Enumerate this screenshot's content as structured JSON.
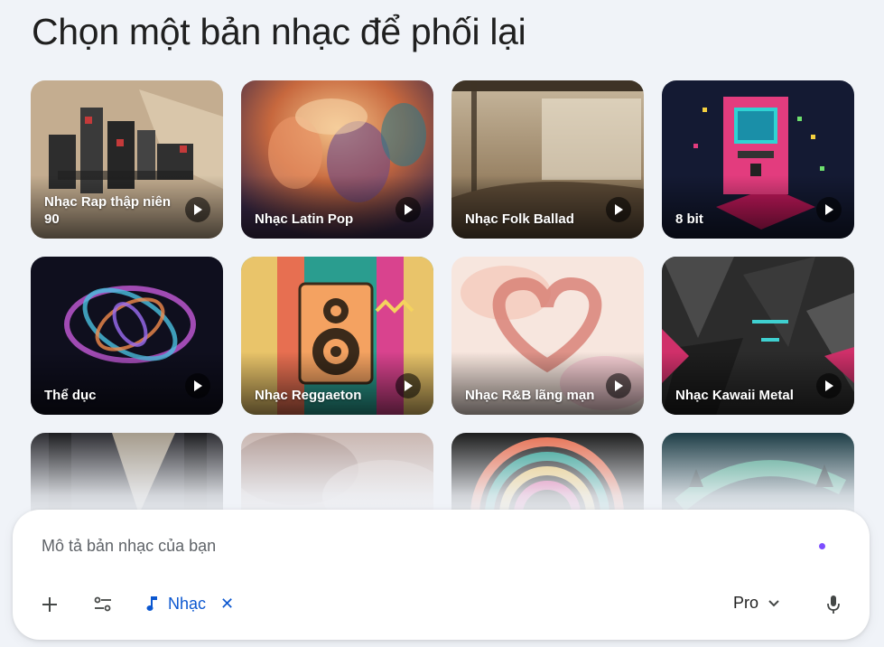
{
  "page": {
    "title": "Chọn một bản nhạc để phối lại"
  },
  "cards": [
    {
      "label": "Nhạc Rap thập niên 90"
    },
    {
      "label": "Nhạc Latin Pop"
    },
    {
      "label": "Nhạc Folk Ballad"
    },
    {
      "label": "8 bit"
    },
    {
      "label": "Thể dục"
    },
    {
      "label": "Nhạc Reggaeton"
    },
    {
      "label": "Nhạc R&B lãng mạn"
    },
    {
      "label": "Nhạc Kawaii Metal"
    }
  ],
  "composer": {
    "placeholder": "Mô tả bản nhạc của bạn",
    "chip_label": "Nhạc",
    "model_label": "Pro"
  },
  "icons": [
    "plus-icon",
    "tune-icon",
    "music-note-icon",
    "close-icon",
    "chevron-down-icon",
    "mic-icon",
    "play-icon"
  ],
  "colors": {
    "accent": "#0b57d0",
    "dot": "#7c4dff",
    "background": "#f0f3f8"
  }
}
